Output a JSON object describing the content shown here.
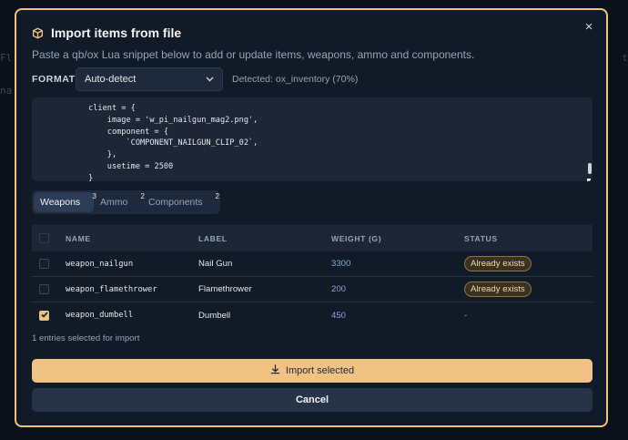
{
  "background": {
    "hint_left_1": "Fl",
    "hint_left_2": "na",
    "hint_right": "t"
  },
  "modal": {
    "title": "Import items from file",
    "icon": "package-icon",
    "subtitle": "Paste a qb/ox Lua snippet below to add or update items, weapons, ammo and components.",
    "close_label": "×",
    "accent_color": "#ecc27f"
  },
  "format": {
    "label": "FORMAT",
    "selected": "Auto-detect",
    "detected": "Detected: ox_inventory (70%)"
  },
  "code": {
    "lines": [
      "            client = {",
      "                image = 'w_pi_nailgun_mag2.png',",
      "                component = {",
      "                    `COMPONENT_NAILGUN_CLIP_02`,",
      "                },",
      "                usetime = 2500",
      "            }",
      "        },"
    ]
  },
  "tabs": [
    {
      "label": "Weapons",
      "count": "3",
      "active": true
    },
    {
      "label": "Ammo",
      "count": "2",
      "active": false
    },
    {
      "label": "Components",
      "count": "2",
      "active": false
    }
  ],
  "table": {
    "headers": {
      "name": "NAME",
      "label": "LABEL",
      "weight": "WEIGHT (G)",
      "status": "STATUS"
    },
    "rows": [
      {
        "name": "weapon_nailgun",
        "label": "Nail Gun",
        "weight": "3300",
        "status": "Already exists",
        "checked": false
      },
      {
        "name": "weapon_flamethrower",
        "label": "Flamethrower",
        "weight": "200",
        "status": "Already exists",
        "checked": false
      },
      {
        "name": "weapon_dumbell",
        "label": "Dumbell",
        "weight": "450",
        "status": "-",
        "checked": true
      }
    ]
  },
  "selection_info": "1 entries selected for import",
  "buttons": {
    "import_label": "Import selected",
    "cancel_label": "Cancel"
  }
}
